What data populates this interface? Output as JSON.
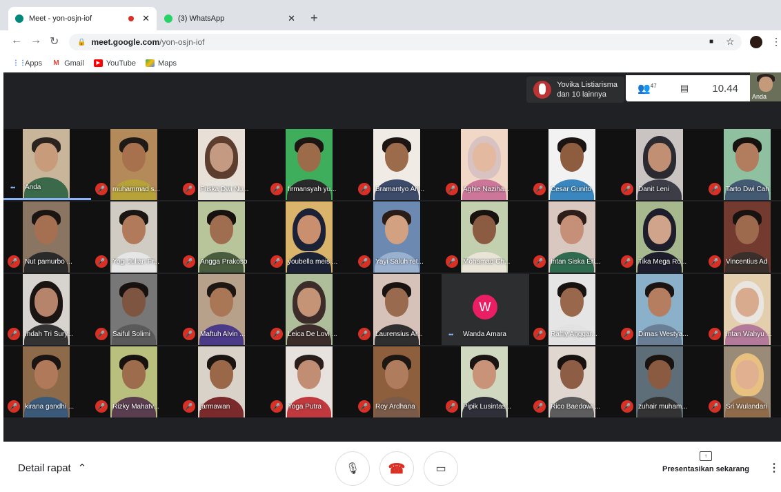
{
  "browser": {
    "tabs": [
      {
        "title": "Meet - yon-osjn-iof",
        "favicon": "meet-icon",
        "color": "#00897b",
        "active": true
      },
      {
        "title": "(3) WhatsApp",
        "favicon": "whatsapp-icon",
        "color": "#25d366",
        "active": false
      }
    ],
    "url_host": "meet.google.com",
    "url_path": "/yon-osjn-iof",
    "bookmarks": [
      {
        "label": "Apps",
        "icon": "apps-grid-icon"
      },
      {
        "label": "Gmail",
        "icon": "gmail-icon"
      },
      {
        "label": "YouTube",
        "icon": "youtube-icon"
      },
      {
        "label": "Maps",
        "icon": "maps-icon"
      }
    ]
  },
  "meeting": {
    "presenter": "Yovika Listiarisma",
    "presenter_more": "dan 10 lainnya",
    "participant_count": "47",
    "time": "10.44",
    "self_label": "Anda",
    "participants": [
      {
        "name": "Anda",
        "muted": false,
        "self": true
      },
      {
        "name": "muhammad s...",
        "muted": true
      },
      {
        "name": "Friska Dwi Nu...",
        "muted": true
      },
      {
        "name": "firmansyah yu...",
        "muted": true
      },
      {
        "name": "Bramantyo Ari...",
        "muted": true
      },
      {
        "name": "Aghie Naziha...",
        "muted": true
      },
      {
        "name": "Cesar Gunito",
        "muted": true
      },
      {
        "name": "Danit Leni",
        "muted": true
      },
      {
        "name": "Tarto Dwi Cah",
        "muted": true
      },
      {
        "name": "Nut pamurbo ...",
        "muted": true
      },
      {
        "name": "Yogi Julian Fr...",
        "muted": true
      },
      {
        "name": "Angga Prakoso",
        "muted": true
      },
      {
        "name": "youbella meis ...",
        "muted": true
      },
      {
        "name": "Yayi Saluh ret...",
        "muted": true
      },
      {
        "name": "Mohamad Ch...",
        "muted": true
      },
      {
        "name": "Intan Siska Erl...",
        "muted": true
      },
      {
        "name": "Tika Mega Ro...",
        "muted": true
      },
      {
        "name": "Vincentius Ad",
        "muted": true
      },
      {
        "name": "Indah Tri Sury...",
        "muted": true
      },
      {
        "name": "Saiful Solimi",
        "muted": true
      },
      {
        "name": "Maftuh Alvin ...",
        "muted": true
      },
      {
        "name": "Leica De Lovi ...",
        "muted": true
      },
      {
        "name": "Laurensius Ar...",
        "muted": true
      },
      {
        "name": "Wanda Amara",
        "muted": false,
        "avatar": "W"
      },
      {
        "name": "Raffly Anggar...",
        "muted": true
      },
      {
        "name": "Dimas Westya...",
        "muted": true
      },
      {
        "name": "Intan Wahyu ...",
        "muted": true
      },
      {
        "name": "kirana gandhi ...",
        "muted": true
      },
      {
        "name": "Rizky Mahatv...",
        "muted": true
      },
      {
        "name": "jarmawan",
        "muted": true
      },
      {
        "name": "Yoga Putra",
        "muted": true
      },
      {
        "name": "Roy Ardhana",
        "muted": true
      },
      {
        "name": "Pipik Lusintas...",
        "muted": true
      },
      {
        "name": "Rico Baedowi ...",
        "muted": true
      },
      {
        "name": "zuhair muham...",
        "muted": true
      },
      {
        "name": "Sri Wulandari",
        "muted": true
      }
    ]
  },
  "controls": {
    "detail_label": "Detail rapat",
    "present_label": "Presentasikan sekarang"
  },
  "colors": {
    "meet_bg": "#202124",
    "mute_red": "#d93025",
    "hangup_red": "#d93025"
  }
}
